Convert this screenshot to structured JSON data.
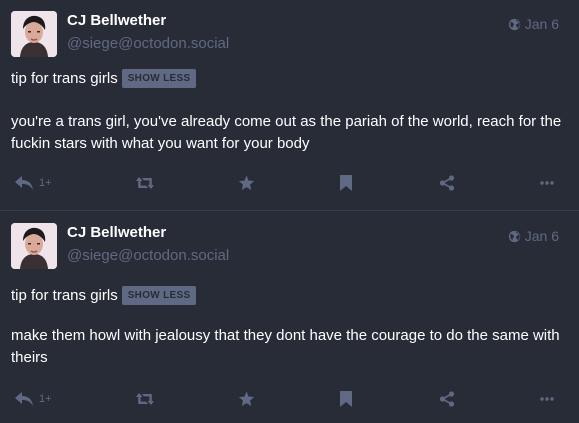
{
  "colors": {
    "background": "#282c37",
    "muted": "#606984",
    "text": "#ffffff",
    "divider": "#393f4f"
  },
  "statuses": [
    {
      "display_name": "CJ Bellwether",
      "acct": "@siege@octodon.social",
      "time": "Jan 6",
      "visibility_icon": "globe-icon",
      "spoiler_text": "tip for trans girls",
      "toggle_label": "SHOW LESS",
      "content": "you're a trans girl, you've already come out as the pariah of the world, reach for the fuckin stars with what you want for your body",
      "reply_count": "1+"
    },
    {
      "display_name": "CJ Bellwether",
      "acct": "@siege@octodon.social",
      "time": "Jan 6",
      "visibility_icon": "globe-icon",
      "spoiler_text": "tip for trans girls",
      "toggle_label": "SHOW LESS",
      "content": "make them howl with jealousy that they dont have the courage to do the same with theirs",
      "reply_count": "1+"
    }
  ],
  "action_icons": [
    "reply-icon",
    "boost-icon",
    "favourite-icon",
    "bookmark-icon",
    "share-icon",
    "more-icon"
  ]
}
